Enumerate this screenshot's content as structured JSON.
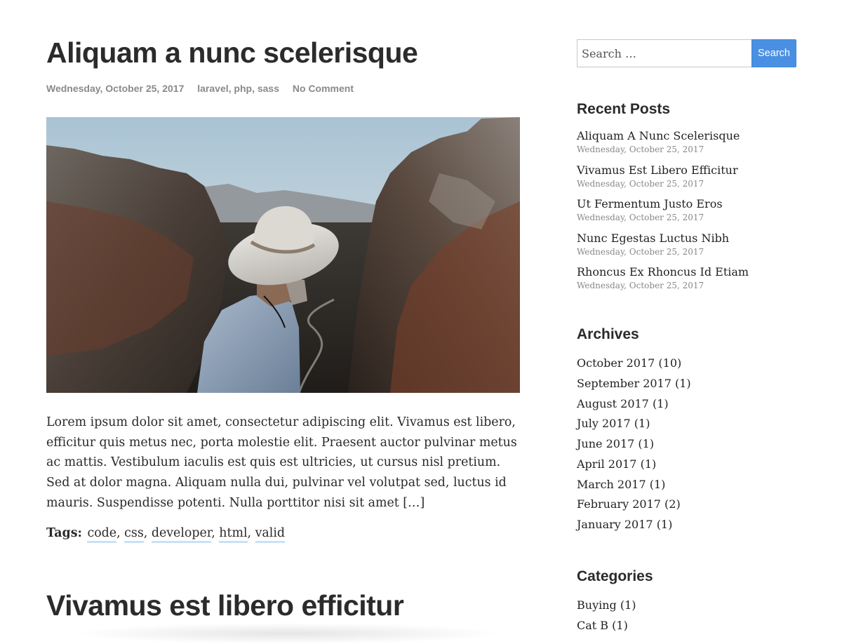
{
  "posts": [
    {
      "title": "Aliquam a nunc scelerisque",
      "date": "Wednesday, October 25, 2017",
      "categories": [
        "laravel",
        "php",
        "sass"
      ],
      "comments": "No Comment",
      "excerpt": "Lorem ipsum dolor sit amet, consectetur adipiscing elit. Vivamus est libero, efficitur quis metus nec, porta molestie elit. Praesent auctor pulvinar metus ac mattis. Vestibulum iaculis est quis est ultricies, ut cursus nisl pretium. Sed at dolor magna. Aliquam nulla dui, pulvinar vel volutpat sed, luctus id mauris. Suspendisse potenti. Nulla porttitor nisi sit amet […]",
      "tags_label": "Tags:",
      "tags": [
        "code",
        "css",
        "developer",
        "html",
        "valid"
      ]
    },
    {
      "title": "Vivamus est libero efficitur"
    }
  ],
  "search": {
    "placeholder": "Search …",
    "value": "",
    "button_label": "Search"
  },
  "recent_posts": {
    "title": "Recent Posts",
    "items": [
      {
        "title": "Aliquam A Nunc Scelerisque",
        "date": "Wednesday, October 25, 2017"
      },
      {
        "title": "Vivamus Est Libero Efficitur",
        "date": "Wednesday, October 25, 2017"
      },
      {
        "title": "Ut Fermentum Justo Eros",
        "date": "Wednesday, October 25, 2017"
      },
      {
        "title": "Nunc Egestas Luctus Nibh",
        "date": "Wednesday, October 25, 2017"
      },
      {
        "title": "Rhoncus Ex Rhoncus Id Etiam",
        "date": "Wednesday, October 25, 2017"
      }
    ]
  },
  "archives": {
    "title": "Archives",
    "items": [
      {
        "label": "October 2017",
        "count": "(10)"
      },
      {
        "label": "September 2017",
        "count": "(1)"
      },
      {
        "label": "August 2017",
        "count": "(1)"
      },
      {
        "label": "July 2017",
        "count": "(1)"
      },
      {
        "label": "June 2017",
        "count": "(1)"
      },
      {
        "label": "April 2017",
        "count": "(1)"
      },
      {
        "label": "March 2017",
        "count": "(1)"
      },
      {
        "label": "February 2017",
        "count": "(2)"
      },
      {
        "label": "January 2017",
        "count": "(1)"
      }
    ]
  },
  "categories": {
    "title": "Categories",
    "items": [
      {
        "label": "Buying",
        "count": "(1)"
      },
      {
        "label": "Cat B",
        "count": "(1)"
      }
    ]
  },
  "colors": {
    "accent": "#4a90e2",
    "tag_underline": "#c6e3f7",
    "meta_text": "#8a8a8a"
  }
}
